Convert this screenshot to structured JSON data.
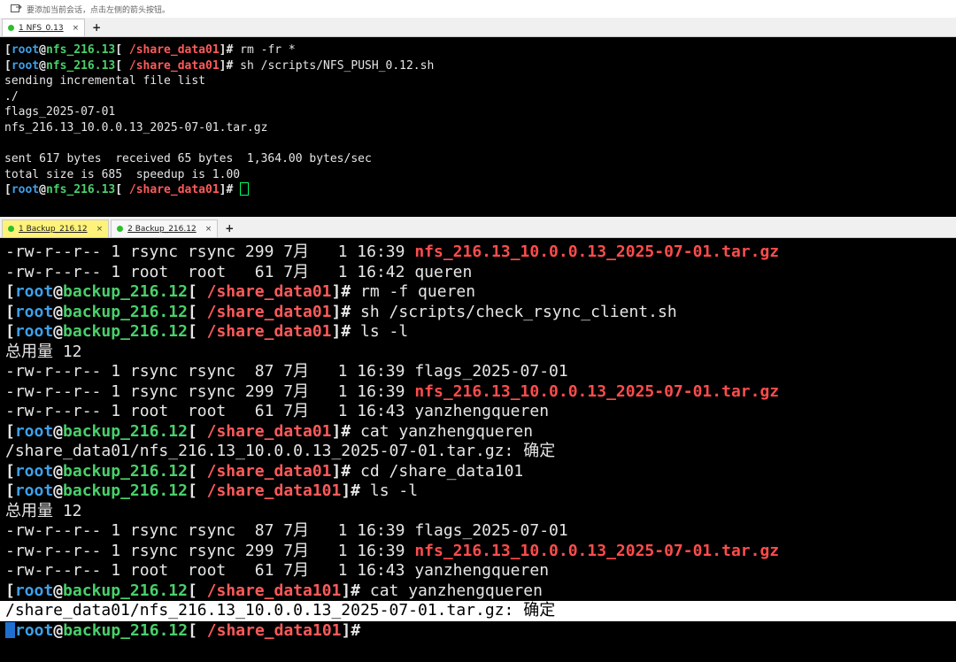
{
  "hint": {
    "text": "要添加当前会话，点击左侧的箭头按钮。"
  },
  "top_tabs": [
    {
      "label": "1 NFS_0.13",
      "close": "×"
    }
  ],
  "plus": "+",
  "prompt_parts": {
    "open": "[",
    "root": "root",
    "at": "@",
    "close": "[ ",
    "end": "]#"
  },
  "top_terminal": {
    "prompts": [
      {
        "host": "nfs_216.13",
        "path": "/share_data01",
        "cmd": " rm -fr *"
      },
      {
        "host": "nfs_216.13",
        "path": "/share_data01",
        "cmd": " sh /scripts/NFS_PUSH_0.12.sh"
      }
    ],
    "output": [
      "sending incremental file list",
      "./",
      "flags_2025-07-01",
      "nfs_216.13_10.0.0.13_2025-07-01.tar.gz",
      "",
      "sent 617 bytes  received 65 bytes  1,364.00 bytes/sec",
      "total size is 685  speedup is 1.00"
    ],
    "last_prompt": {
      "host": "nfs_216.13",
      "path": "/share_data01",
      "cmd": " "
    }
  },
  "mid_tabs": [
    {
      "label": "1 Backup_216.12",
      "close": "×"
    },
    {
      "label": "2 Backup_216.12",
      "close": "×"
    }
  ],
  "bottom_terminal": {
    "l1": {
      "pre": "-rw-r--r-- 1 rsync rsync 299 7月   1 16:39 ",
      "file": "nfs_216.13_10.0.0.13_2025-07-01.tar.gz"
    },
    "l2": "-rw-r--r-- 1 root  root   61 7月   1 16:42 queren",
    "p3": {
      "host": "backup_216.12",
      "path": "/share_data01",
      "cmd": " rm -f queren"
    },
    "p4": {
      "host": "backup_216.12",
      "path": "/share_data01",
      "cmd": " sh /scripts/check_rsync_client.sh"
    },
    "p5": {
      "host": "backup_216.12",
      "path": "/share_data01",
      "cmd": " ls -l"
    },
    "l6": "总用量 12",
    "l7": "-rw-r--r-- 1 rsync rsync  87 7月   1 16:39 flags_2025-07-01",
    "l8": {
      "pre": "-rw-r--r-- 1 rsync rsync 299 7月   1 16:39 ",
      "file": "nfs_216.13_10.0.0.13_2025-07-01.tar.gz"
    },
    "l9": "-rw-r--r-- 1 root  root   61 7月   1 16:43 yanzhengqueren",
    "p10": {
      "host": "backup_216.12",
      "path": "/share_data01",
      "cmd": " cat yanzhengqueren"
    },
    "l11": "/share_data01/nfs_216.13_10.0.0.13_2025-07-01.tar.gz: 确定",
    "p12": {
      "host": "backup_216.12",
      "path": "/share_data01",
      "cmd": " cd /share_data101"
    },
    "p13": {
      "host": "backup_216.12",
      "path": "/share_data101",
      "cmd": " ls -l"
    },
    "l14": "总用量 12",
    "l15": "-rw-r--r-- 1 rsync rsync  87 7月   1 16:39 flags_2025-07-01",
    "l16": {
      "pre": "-rw-r--r-- 1 rsync rsync 299 7月   1 16:39 ",
      "file": "nfs_216.13_10.0.0.13_2025-07-01.tar.gz"
    },
    "l17": "-rw-r--r-- 1 root  root   61 7月   1 16:43 yanzhengqueren",
    "p18": {
      "host": "backup_216.12",
      "path": "/share_data101",
      "cmd": " cat yanzhengqueren"
    },
    "l19": "/share_data01/nfs_216.13_10.0.0.13_2025-07-01.tar.gz: 确定",
    "p20": {
      "host": "backup_216.12",
      "path": "/share_data101",
      "cmd": ""
    }
  },
  "colors": {
    "user": "#3ea0e8",
    "host": "#48d16a",
    "path": "#ff5a5a",
    "file_red": "#ff4c4c",
    "tab_active_yellow": "#fff27a",
    "status_dot": "#2bbf2b"
  }
}
